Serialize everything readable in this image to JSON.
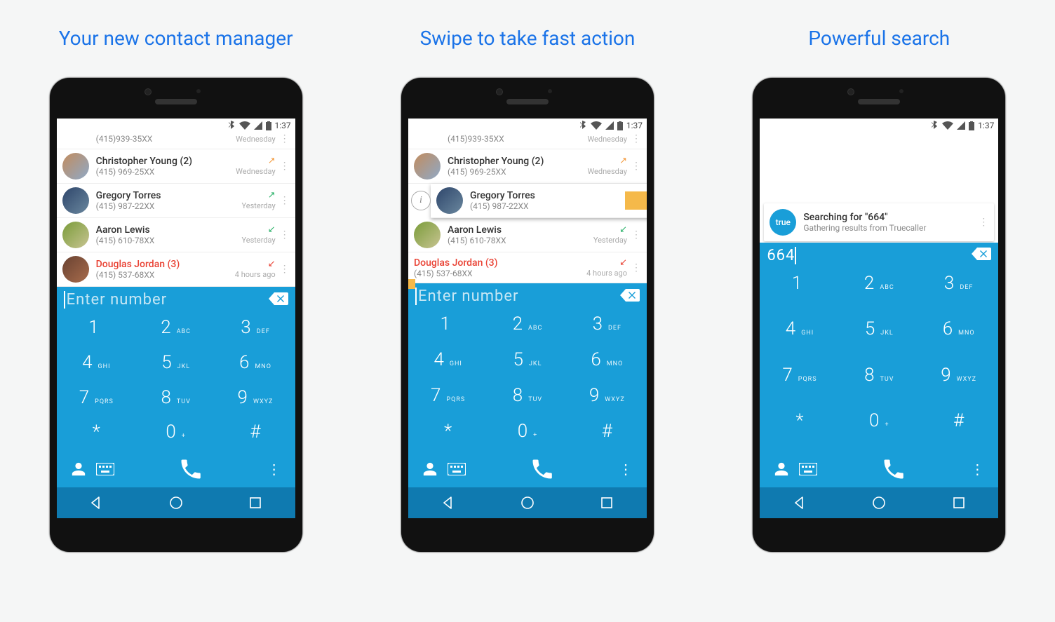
{
  "slides": {
    "one": {
      "title": "Your new contact manager"
    },
    "two": {
      "title": "Swipe to take fast action"
    },
    "three": {
      "title": "Powerful search"
    }
  },
  "status": {
    "time": "1:37"
  },
  "calls": {
    "r0": {
      "name": "",
      "num": "(415)939-35XX",
      "when": "Wednesday",
      "dir": ""
    },
    "r1": {
      "name": "Christopher Young (2)",
      "num": "(415) 969-25XX",
      "when": "Wednesday",
      "dir": "out"
    },
    "r2": {
      "name": "Gregory Torres",
      "num": "(415) 987-22XX",
      "when": "Yesterday",
      "dir": "in"
    },
    "r3": {
      "name": "Aaron Lewis",
      "num": "(415) 610-78XX",
      "when": "Yesterday",
      "dir": "in"
    },
    "r4": {
      "name": "Douglas Jordan (3)",
      "num": "(415) 537-68XX",
      "when": "4 hours ago",
      "dir": "miss"
    }
  },
  "dial": {
    "placeholder": "Enter number",
    "typed": "664",
    "keys": {
      "1": {
        "d": "1",
        "l": ""
      },
      "2": {
        "d": "2",
        "l": "ABC"
      },
      "3": {
        "d": "3",
        "l": "DEF"
      },
      "4": {
        "d": "4",
        "l": "GHI"
      },
      "5": {
        "d": "5",
        "l": "JKL"
      },
      "6": {
        "d": "6",
        "l": "MNO"
      },
      "7": {
        "d": "7",
        "l": "PQRS"
      },
      "8": {
        "d": "8",
        "l": "TUV"
      },
      "9": {
        "d": "9",
        "l": "WXYZ"
      },
      "s": {
        "d": "*",
        "l": ""
      },
      "0": {
        "d": "0",
        "l": "+"
      },
      "h": {
        "d": "#",
        "l": ""
      }
    }
  },
  "search": {
    "badge": "true",
    "line1": "Searching for \"664\"",
    "line2": "Gathering results from Truecaller"
  }
}
